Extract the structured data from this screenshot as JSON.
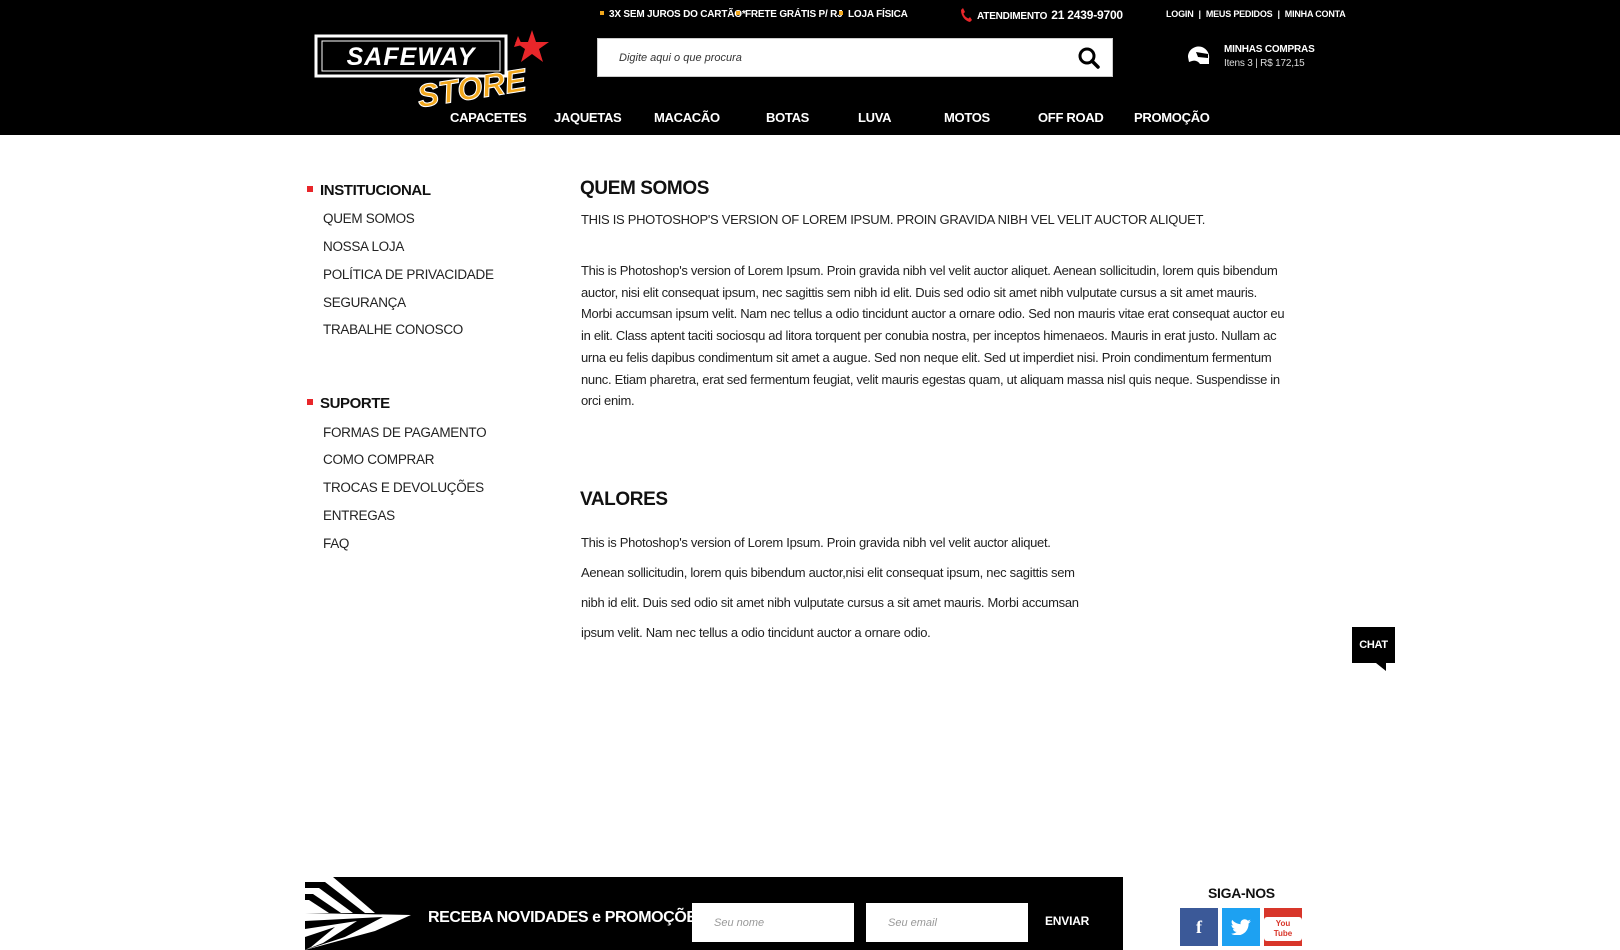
{
  "topbar": {
    "promos": [
      "3X SEM JUROS DO CARTÃO*",
      "FRETE GRÁTIS P/ RJ",
      "LOJA FÍSICA"
    ],
    "atendimento_label": "ATENDIMENTO",
    "atendimento_phone": "21 2439-9700",
    "account_links": [
      "LOGIN",
      "MEUS PEDIDOS",
      "MINHA CONTA"
    ],
    "separator": "|"
  },
  "logo": {
    "line1": "SAFEWAY",
    "line2": "STORE"
  },
  "search": {
    "placeholder": "Digite aqui o que procura"
  },
  "cart": {
    "title": "MINHAS COMPRAS",
    "info": "Itens 3  |  R$ 172,15"
  },
  "nav": [
    "CAPACETES",
    "JAQUETAS",
    "MACACÃO",
    "BOTAS",
    "LUVA",
    "MOTOS",
    "OFF ROAD",
    "PROMOÇÃO"
  ],
  "sidebar": {
    "institucional": {
      "heading": "INSTITUCIONAL",
      "links": [
        "QUEM SOMOS",
        "NOSSA LOJA",
        "POLÍTICA DE PRIVACIDADE",
        "SEGURANÇA",
        "TRABALHE CONOSCO"
      ]
    },
    "suporte": {
      "heading": "SUPORTE",
      "links": [
        "FORMAS DE PAGAMENTO",
        "COMO COMPRAR",
        "TROCAS E DEVOLUÇÕES",
        "ENTREGAS",
        "FAQ"
      ]
    }
  },
  "content": {
    "section1_title": "QUEM SOMOS",
    "section1_subtitle": "THIS IS PHOTOSHOP'S VERSION  OF LOREM IPSUM. PROIN GRAVIDA NIBH VEL VELIT AUCTOR ALIQUET.",
    "section1_body": "This is Photoshop's version  of Lorem Ipsum. Proin gravida nibh vel velit auctor aliquet. Aenean sollicitudin, lorem quis bibendum auctor, nisi elit consequat ipsum, nec sagittis sem nibh id elit. Duis sed odio sit amet nibh vulputate cursus a sit amet mauris. Morbi accumsan ipsum velit. Nam nec tellus a odio tincidunt auctor a ornare odio. Sed non  mauris vitae erat consequat auctor eu in elit. Class aptent taciti sociosqu ad litora torquent per conubia nostra, per inceptos himenaeos. Mauris in erat justo. Nullam ac urna eu felis dapibus condimentum sit amet a augue. Sed non neque elit. Sed ut imperdiet nisi. Proin condimentum fermentum nunc. Etiam pharetra, erat sed fermentum feugiat, velit mauris egestas quam, ut aliquam massa nisl quis neque. Suspendisse in orci enim.",
    "section2_title": "VALORES",
    "section2_body": "This is Photoshop's version  of Lorem Ipsum. Proin gravida nibh vel velit auctor aliquet. Aenean sollicitudin, lorem quis bibendum auctor,nisi elit consequat ipsum, nec sagittis sem nibh id elit. Duis sed odio sit amet nibh vulputate cursus a sit amet mauris. Morbi accumsan ipsum velit. Nam nec tellus a odio tincidunt auctor a ornare odio."
  },
  "chat": {
    "label": "CHAT"
  },
  "newsletter": {
    "title": "RECEBA NOVIDADES e PROMOÇÕES",
    "name_placeholder": "Seu nome",
    "email_placeholder": "Seu email",
    "send_label": "ENVIAR"
  },
  "social": {
    "title": "SIGA-NOS",
    "facebook": "f",
    "youtube": "You Tube"
  },
  "colors": {
    "header_bg": "#000000",
    "accent_red": "#e8262a",
    "accent_orange": "#f2a81d"
  }
}
